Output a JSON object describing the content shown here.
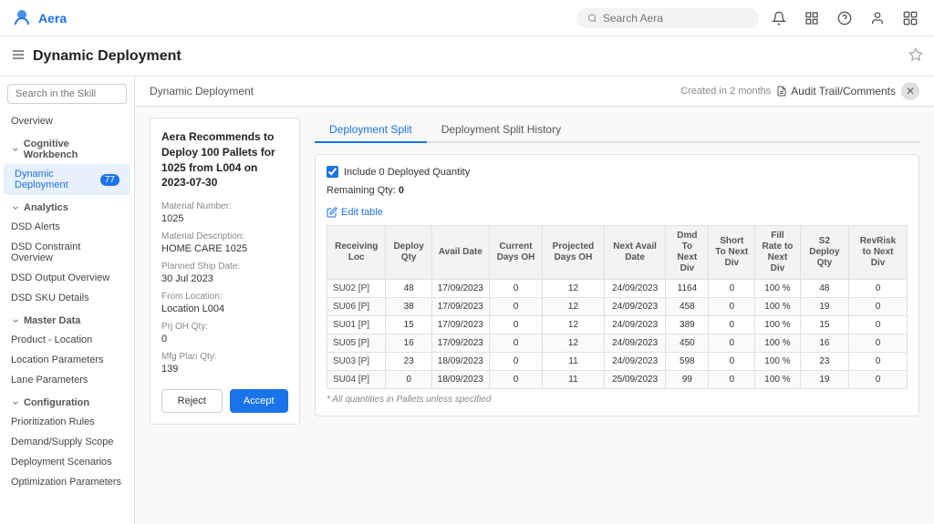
{
  "app": {
    "logo": "Aera",
    "search_placeholder": "Search Aera"
  },
  "page": {
    "title": "Dynamic Deployment"
  },
  "breadcrumb": "Dynamic Deployment",
  "created_label": "Created in 2 months",
  "audit_label": "Audit Trail/Comments",
  "sidebar": {
    "search_placeholder": "Search in the Skill",
    "sections": [
      {
        "label": "Overview",
        "items": []
      },
      {
        "label": "Cognitive Workbench",
        "items": [
          {
            "label": "Dynamic Deployment",
            "badge": "77",
            "active": true
          }
        ]
      },
      {
        "label": "Analytics",
        "items": [
          {
            "label": "DSD Alerts"
          },
          {
            "label": "DSD Constraint Overview"
          },
          {
            "label": "DSD Output Overview"
          },
          {
            "label": "DSD SKU Details"
          }
        ]
      },
      {
        "label": "Master Data",
        "items": [
          {
            "label": "Product - Location"
          },
          {
            "label": "Location Parameters"
          },
          {
            "label": "Lane Parameters"
          }
        ]
      },
      {
        "label": "Configuration",
        "items": [
          {
            "label": "Prioritization Rules"
          },
          {
            "label": "Demand/Supply Scope"
          },
          {
            "label": "Deployment Scenarios"
          },
          {
            "label": "Optimization Parameters"
          }
        ]
      }
    ]
  },
  "tabs": [
    {
      "label": "Deployment Split",
      "active": true
    },
    {
      "label": "Deployment Split History",
      "active": false
    }
  ],
  "info_panel": {
    "title": "Aera Recommends to Deploy 100 Pallets for 1025 from L004 on 2023-07-30",
    "fields": [
      {
        "label": "Material Number:",
        "value": "1025"
      },
      {
        "label": "Material Description:",
        "value": "HOME CARE 1025"
      },
      {
        "label": "Planned Ship Date:",
        "value": "30 Jul 2023"
      },
      {
        "label": "From Location:",
        "value": "Location L004"
      },
      {
        "label": "Prj OH Qty:",
        "value": "0"
      },
      {
        "label": "Mfg Plan Qty:",
        "value": "139"
      }
    ],
    "reject_label": "Reject",
    "accept_label": "Accept"
  },
  "deployment": {
    "include_label": "Include 0 Deployed Quantity",
    "remaining_label": "Remaining Qty:",
    "remaining_value": "0",
    "edit_table_label": "Edit table",
    "table_note": "* All quantities in Pallets unless specified",
    "table_headers": [
      "Receiving Loc",
      "Deploy Qty",
      "Avail Date",
      "Current Days OH",
      "Projected Days OH",
      "Next Avail Date",
      "Dmd To Next Div",
      "Short To Next Div",
      "Fill Rate to Next Div",
      "S2 Deploy Qty",
      "RevRisk to Next Div"
    ],
    "table_rows": [
      {
        "loc": "SU02 [P]",
        "deploy_qty": "48",
        "avail_date": "17/09/2023",
        "current_days": "0",
        "projected_days": "12",
        "next_avail": "24/09/2023",
        "dmd_next": "1164",
        "short_next": "0",
        "fill_rate": "100 %",
        "s2_deploy": "48",
        "revrisk": "0"
      },
      {
        "loc": "SU06 [P]",
        "deploy_qty": "38",
        "avail_date": "17/09/2023",
        "current_days": "0",
        "projected_days": "12",
        "next_avail": "24/09/2023",
        "dmd_next": "458",
        "short_next": "0",
        "fill_rate": "100 %",
        "s2_deploy": "19",
        "revrisk": "0"
      },
      {
        "loc": "SU01 [P]",
        "deploy_qty": "15",
        "avail_date": "17/09/2023",
        "current_days": "0",
        "projected_days": "12",
        "next_avail": "24/09/2023",
        "dmd_next": "389",
        "short_next": "0",
        "fill_rate": "100 %",
        "s2_deploy": "15",
        "revrisk": "0"
      },
      {
        "loc": "SU05 [P]",
        "deploy_qty": "16",
        "avail_date": "17/09/2023",
        "current_days": "0",
        "projected_days": "12",
        "next_avail": "24/09/2023",
        "dmd_next": "450",
        "short_next": "0",
        "fill_rate": "100 %",
        "s2_deploy": "16",
        "revrisk": "0"
      },
      {
        "loc": "SU03 [P]",
        "deploy_qty": "23",
        "avail_date": "18/09/2023",
        "current_days": "0",
        "projected_days": "11",
        "next_avail": "24/09/2023",
        "dmd_next": "598",
        "short_next": "0",
        "fill_rate": "100 %",
        "s2_deploy": "23",
        "revrisk": "0"
      },
      {
        "loc": "SU04 [P]",
        "deploy_qty": "0",
        "avail_date": "18/09/2023",
        "current_days": "0",
        "projected_days": "11",
        "next_avail": "25/09/2023",
        "dmd_next": "99",
        "short_next": "0",
        "fill_rate": "100 %",
        "s2_deploy": "19",
        "revrisk": "0"
      }
    ]
  }
}
